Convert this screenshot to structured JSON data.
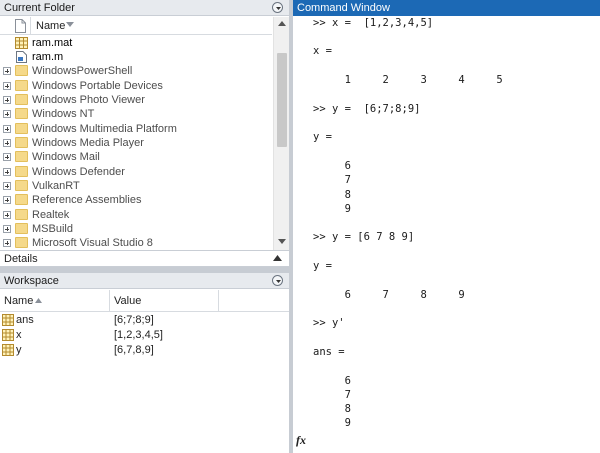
{
  "current_folder": {
    "title": "Current Folder",
    "name_column": "Name",
    "items": [
      {
        "label": "ram.mat",
        "kind": "mat"
      },
      {
        "label": "ram.m",
        "kind": "m"
      },
      {
        "label": "WindowsPowerShell",
        "kind": "folder"
      },
      {
        "label": "Windows Portable Devices",
        "kind": "folder"
      },
      {
        "label": "Windows Photo Viewer",
        "kind": "folder"
      },
      {
        "label": "Windows NT",
        "kind": "folder"
      },
      {
        "label": "Windows Multimedia Platform",
        "kind": "folder"
      },
      {
        "label": "Windows Media Player",
        "kind": "folder"
      },
      {
        "label": "Windows Mail",
        "kind": "folder"
      },
      {
        "label": "Windows Defender",
        "kind": "folder"
      },
      {
        "label": "VulkanRT",
        "kind": "folder"
      },
      {
        "label": "Reference Assemblies",
        "kind": "folder"
      },
      {
        "label": "Realtek",
        "kind": "folder"
      },
      {
        "label": "MSBuild",
        "kind": "folder"
      },
      {
        "label": "Microsoft Visual Studio 8",
        "kind": "folder"
      }
    ]
  },
  "details": {
    "title": "Details"
  },
  "workspace": {
    "title": "Workspace",
    "columns": {
      "name": "Name",
      "value": "Value"
    },
    "rows": [
      {
        "name": "ans",
        "value": "[6;7;8;9]"
      },
      {
        "name": "x",
        "value": "[1,2,3,4,5]"
      },
      {
        "name": "y",
        "value": "[6,7,8,9]"
      }
    ]
  },
  "command_window": {
    "title": "Command Window",
    "lines": [
      ">> x =  [1,2,3,4,5]",
      "",
      "x =",
      "",
      "     1     2     3     4     5",
      "",
      ">> y =  [6;7;8;9]",
      "",
      "y =",
      "",
      "     6",
      "     7",
      "     8",
      "     9",
      "",
      ">> y = [6 7 8 9]",
      "",
      "y =",
      "",
      "     6     7     8     9",
      "",
      ">> y'",
      "",
      "ans =",
      "",
      "     6",
      "     7",
      "     8",
      "     9"
    ],
    "fx_symbol": "fx"
  },
  "colors": {
    "accent": "#1c69b5",
    "folder": "#f5d98a"
  }
}
